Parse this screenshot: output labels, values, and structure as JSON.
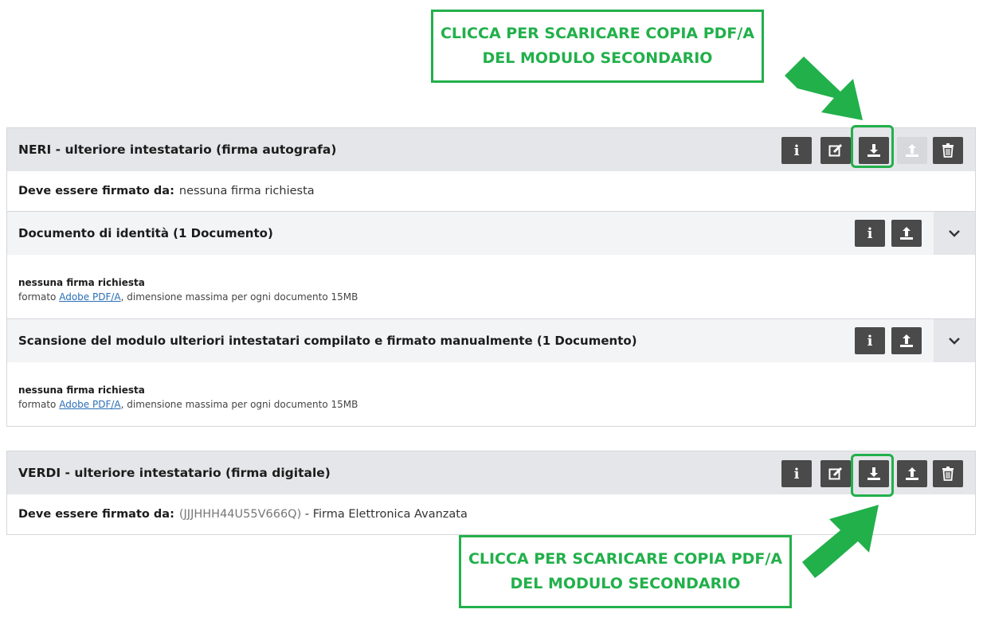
{
  "annotations": {
    "top_callout": {
      "line1": "CLICCA PER SCARICARE COPIA PDF/A",
      "line2": "DEL MODULO SECONDARIO"
    },
    "bottom_callout": {
      "line1": "CLICCA PER SCARICARE COPIA PDF/A",
      "line2": "DEL MODULO SECONDARIO"
    },
    "accent_color": "#22b04b"
  },
  "cards": [
    {
      "name_bold": "NERI",
      "name_rest": " - ulteriore intestatario (firma autografa)",
      "signed_by_label": "Deve essere firmato da:",
      "signed_by_value": "nessuna firma richiesta",
      "actions": [
        "info-icon",
        "edit-icon",
        "download-icon",
        "upload-icon (disabled)",
        "trash-icon"
      ],
      "documents": [
        {
          "title": "Documento di identità (1 Documento)",
          "signature": "nessuna firma richiesta",
          "format_prefix": "formato ",
          "format_link": "Adobe PDF/A",
          "format_suffix": ", dimensione massima per ogni documento 15MB"
        },
        {
          "title": "Scansione del modulo ulteriori intestatari compilato e firmato manualmente (1 Documento)",
          "signature": "nessuna firma richiesta",
          "format_prefix": "formato ",
          "format_link": "Adobe PDF/A",
          "format_suffix": ", dimensione massima per ogni documento 15MB"
        }
      ]
    },
    {
      "name_bold": "VERDI",
      "name_rest": " - ulteriore intestatario (firma digitale)",
      "signed_by_label": "Deve essere firmato da:",
      "signed_by_code": "(JJJHHH44U55V666Q)",
      "signed_by_value": " - Firma Elettronica Avanzata",
      "actions": [
        "info-icon",
        "edit-icon",
        "download-icon",
        "upload-icon",
        "trash-icon"
      ]
    }
  ],
  "colors": {
    "header_bg": "#e5e6e9",
    "button_bg": "#4a4a4a",
    "button_disabled": "#d7d8db",
    "link": "#2a6fb6"
  }
}
